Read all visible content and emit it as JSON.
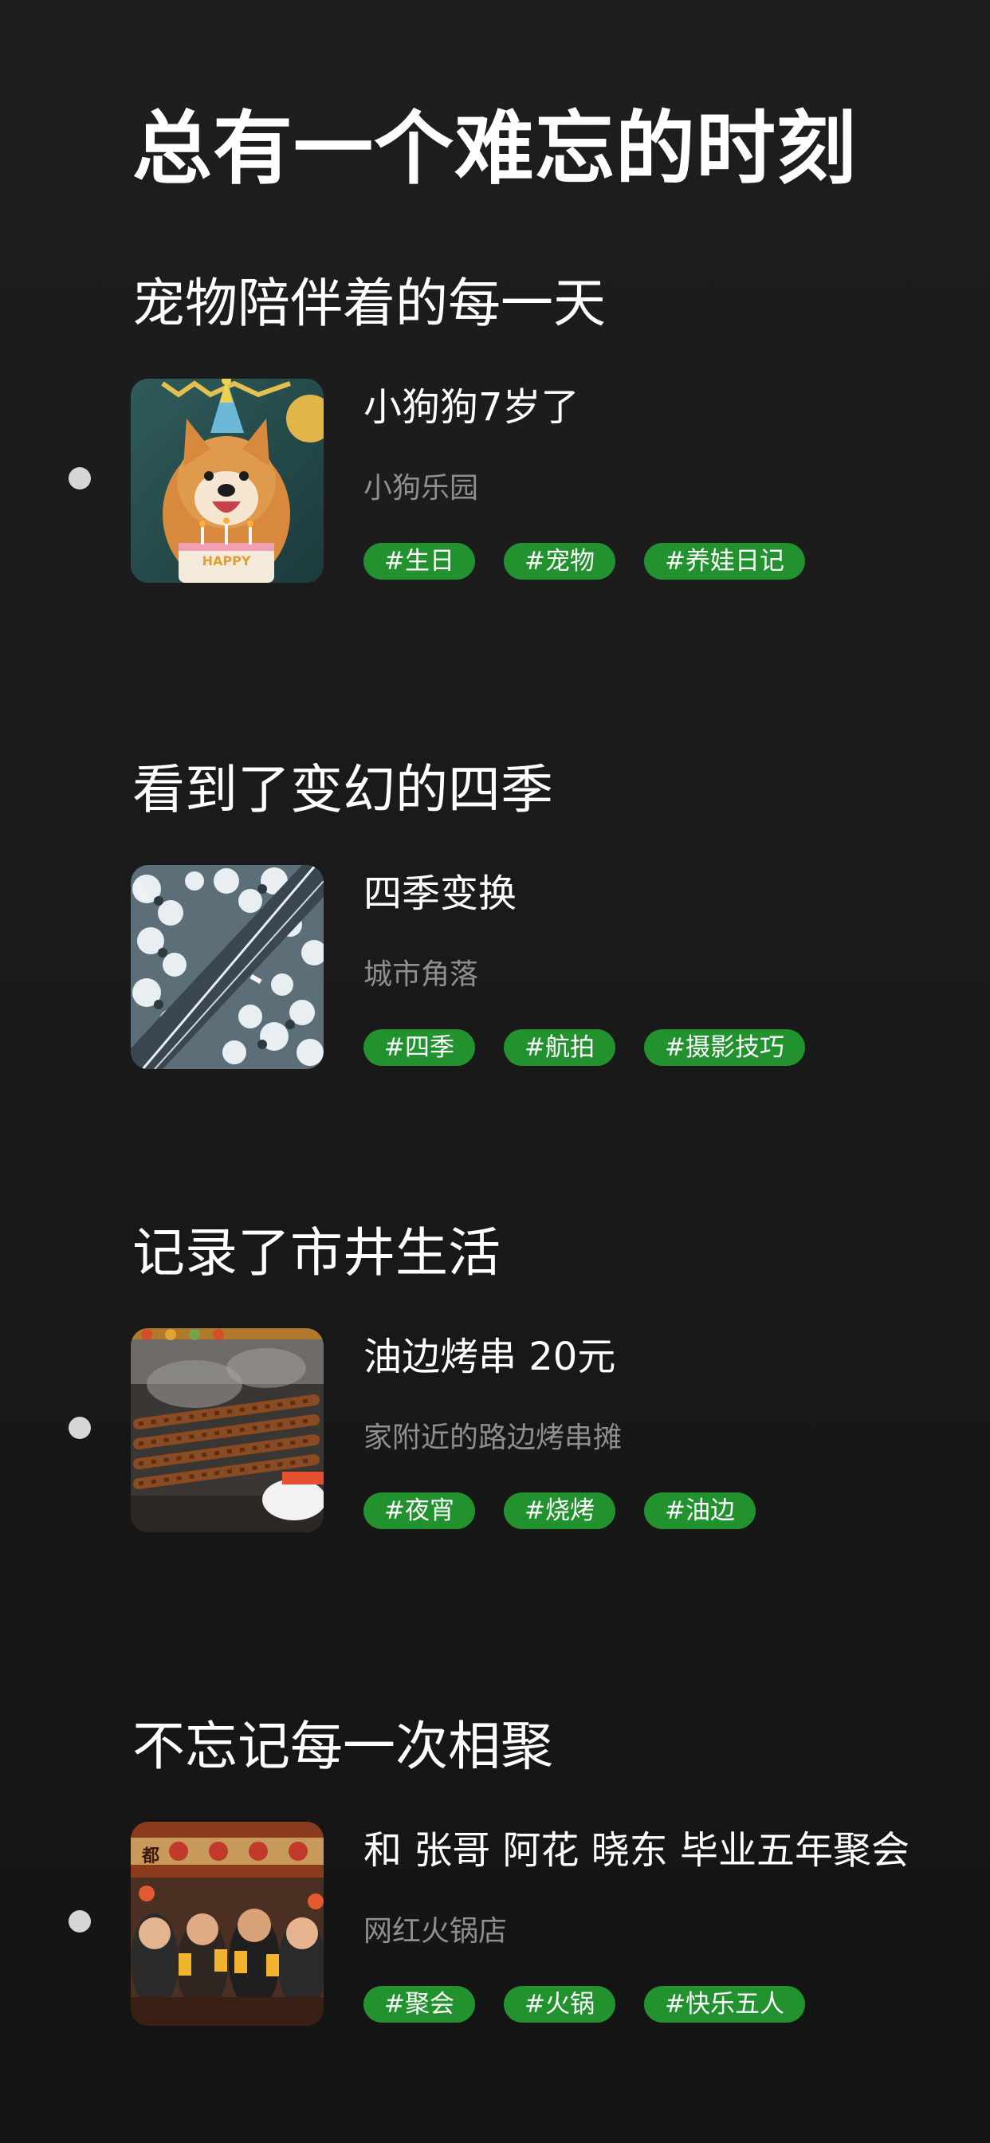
{
  "page": {
    "title": "总有一个难忘的时刻"
  },
  "sections": [
    {
      "heading": "宠物陪伴着的每一天",
      "has_dot": true,
      "card": {
        "title": "小狗狗7岁了",
        "subtitle": "小狗乐园",
        "tags": [
          "#生日",
          "#宠物",
          "#养娃日记"
        ],
        "image": "birthday-dog-photo",
        "cake_text": "HAPPY"
      }
    },
    {
      "heading": "看到了变幻的四季",
      "has_dot": false,
      "card": {
        "title": "四季变换",
        "subtitle": "城市角落",
        "tags": [
          "#四季",
          "#航拍",
          "#摄影技巧"
        ],
        "image": "snowy-forest-aerial-photo"
      }
    },
    {
      "heading": "记录了市井生活",
      "has_dot": true,
      "card": {
        "title": "油边烤串 20元",
        "subtitle": "家附近的路边烤串摊",
        "tags": [
          "#夜宵",
          "#烧烤",
          "#油边"
        ],
        "image": "bbq-skewers-photo"
      }
    },
    {
      "heading": "不忘记每一次相聚",
      "has_dot": true,
      "card": {
        "title": "和 张哥 阿花 晓东  毕业五年聚会",
        "subtitle": "网红火锅店",
        "tags": [
          "#聚会",
          "#火锅",
          "#快乐五人"
        ],
        "image": "hotpot-friends-photo",
        "sign_text": "都"
      }
    }
  ],
  "colors": {
    "background": "#1a1a1a",
    "tag_background": "#22922e",
    "dot": "#d6d6d6",
    "subtitle": "#8f8f8f"
  }
}
